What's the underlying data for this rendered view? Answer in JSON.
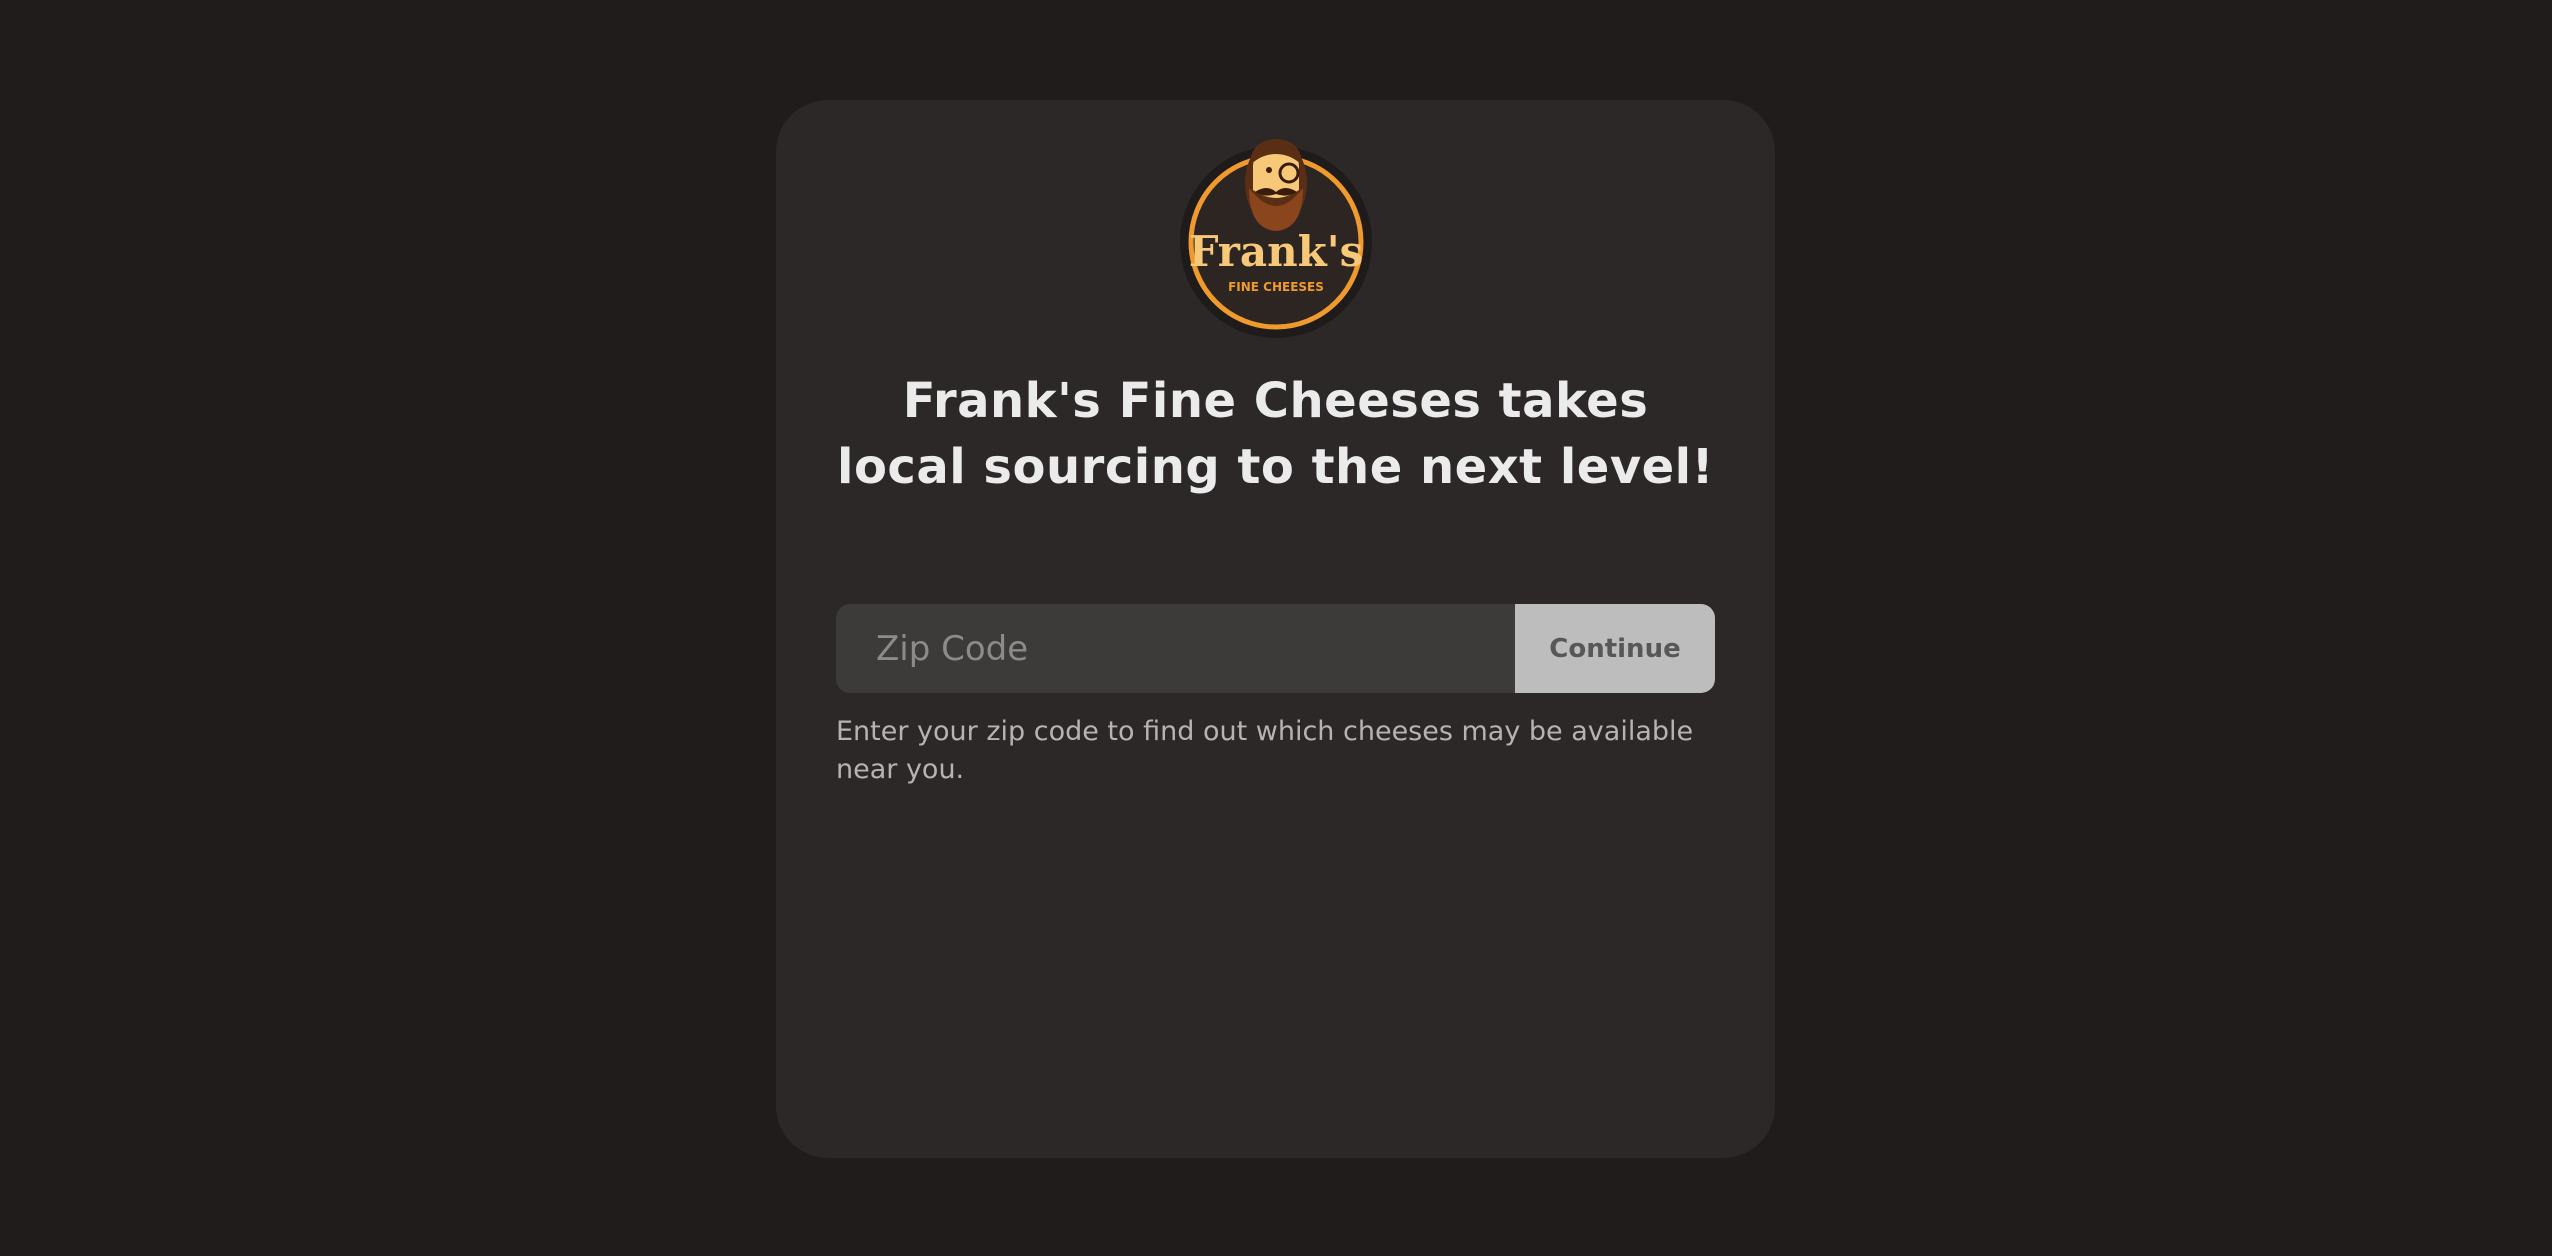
{
  "brand": {
    "logo_icon": "franks-fine-cheeses-logo",
    "logo_wordmark": "Frank's",
    "logo_tagline": "FINE CHEESES",
    "colors": {
      "background": "#201c1c",
      "card": "#2b2827",
      "logo_orange": "#f09a2e",
      "logo_ring": "#2c2522"
    }
  },
  "main": {
    "headline": "Frank's Fine Cheeses takes local sourcing to the next level!",
    "zip_placeholder": "Zip Code",
    "zip_value": "",
    "continue_label": "Continue",
    "helper_text": "Enter your zip code to find out which cheeses may be available near you."
  }
}
